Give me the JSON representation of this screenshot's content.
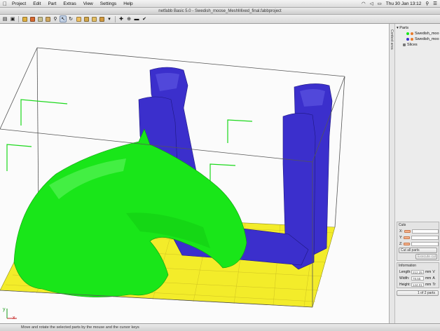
{
  "menubar": {
    "items": [
      "Project",
      "Edit",
      "Part",
      "Extras",
      "View",
      "Settings",
      "Help"
    ],
    "clock": "Thu 30 Jan  13:12"
  },
  "window": {
    "title": "netfabb Basic 5.0 - Swedish_moose_MeshMixed_final.fabbproject"
  },
  "toolbar": {
    "icons": [
      "open-icon",
      "save-icon",
      "color-part-icon",
      "shade-icon",
      "ruler-icon",
      "search-icon",
      "select-arrow-icon",
      "rotate-icon",
      "view-cube-icon",
      "view-front-icon",
      "add-part-icon",
      "cut-icon",
      "minus-icon",
      "check-icon"
    ]
  },
  "viewport": {
    "axis_x": "x",
    "axis_y": "y"
  },
  "vertical_tab": {
    "label": "Context area"
  },
  "tree": {
    "root_label": "Parts",
    "items": [
      "Swedish_moo",
      "Swedish_moo"
    ],
    "slices_label": "Slices"
  },
  "cuts": {
    "title": "Cuts",
    "x_label": "X:",
    "y_label": "Y:",
    "z_label": "Z:",
    "x_value": "",
    "y_value": "",
    "z_value": "",
    "cut_all_label": "Cut all parts",
    "execute_label": "Execute cut"
  },
  "info": {
    "title": "Information",
    "length_label": "Length:",
    "length_value": "212.25",
    "width_label": "Width:",
    "width_value": "78.55",
    "height_label": "Height:",
    "height_value": "144.01",
    "unit": "mm",
    "volume_abbr": "V",
    "area_abbr": "A",
    "triangles_abbr": "Tr",
    "parts_count": "1 of 2 parts"
  },
  "statusbar": {
    "text": "Move and rotate the selected parts by the mouse and the cursor keys"
  },
  "colors": {
    "part_green": "#19e619",
    "part_blue": "#3b2fcc",
    "platform_yellow": "#f3ec2a",
    "bounding_box": "#555555",
    "axis_red": "#c62020",
    "axis_green": "#1a9a1a"
  }
}
